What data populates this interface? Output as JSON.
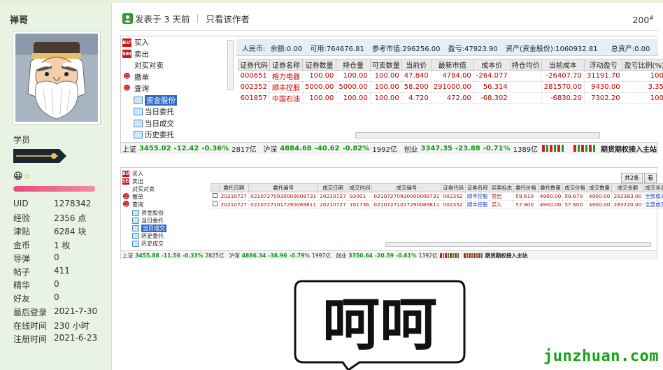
{
  "user": {
    "name": "禅哥",
    "rank": "学员",
    "progress_fraction": 0.9,
    "stats": [
      {
        "label": "UID",
        "value": "1278342"
      },
      {
        "label": "经验",
        "value": "2356 点"
      },
      {
        "label": "津贴",
        "value": "6284 块"
      },
      {
        "label": "金币",
        "value": "1 枚"
      },
      {
        "label": "导弹",
        "value": "0"
      },
      {
        "label": "帖子",
        "value": "411"
      },
      {
        "label": "精华",
        "value": "0"
      },
      {
        "label": "好友",
        "value": "0"
      },
      {
        "label": "最后登录",
        "value": "2021-7-30"
      },
      {
        "label": "在线时间",
        "value": "230 小时"
      },
      {
        "label": "注册时间",
        "value": "2021-6-23"
      }
    ]
  },
  "post": {
    "posted_label": "发表于 3 天前",
    "author_only_link": "只看该作者",
    "floor_number": "200",
    "floor_suffix": "#"
  },
  "shot1": {
    "tree": [
      {
        "label": "买入",
        "icon": "BUY",
        "color": "#c41c1c"
      },
      {
        "label": "卖出",
        "icon": "SELL",
        "color": "#c41c1c"
      },
      {
        "label": "对买对卖",
        "icon": "",
        "color": ""
      },
      {
        "label": "撤单",
        "icon": "bug",
        "color": ""
      },
      {
        "label": "查询",
        "icon": "bug",
        "color": ""
      },
      {
        "label": "资金股份",
        "icon": "folder",
        "selected": true
      },
      {
        "label": "当日委托",
        "icon": "folder"
      },
      {
        "label": "当日成交",
        "icon": "folder"
      },
      {
        "label": "历史委托",
        "icon": "folder"
      },
      {
        "label": "历史成交",
        "icon": "folder"
      }
    ],
    "account": {
      "currency": "人民币:",
      "balance": "余额:0.00",
      "available": "可用:764676.81",
      "ref_market_value": "参考市值:296256.00",
      "pnl": "盈亏:47923.90",
      "assets": "资产(资金股份):1060932.81",
      "total_assets": "总资产:0.00"
    },
    "columns": [
      "证券代码",
      "证券名称",
      "证券数量",
      "持仓量",
      "可卖数量",
      "当前价",
      "最新市值",
      "成本价",
      "持仓均价",
      "当前成本",
      "浮动盈亏",
      "盈亏比例(%)"
    ],
    "rows": [
      [
        "000651",
        "格力电器",
        "100.00",
        "100.00",
        "100.00",
        "47.840",
        "4784.00",
        "-264.077",
        "",
        "-26407.70",
        "31191.70",
        "100"
      ],
      [
        "002352",
        "顺丰控股",
        "5000.00",
        "5000.00",
        "100.00",
        "58.200",
        "291000.00",
        "56.314",
        "",
        "281570.00",
        "9430.00",
        "3.35"
      ],
      [
        "601857",
        "中国石油",
        "100.00",
        "100.00",
        "100.00",
        "4.720",
        "472.00",
        "-68.302",
        "",
        "-6830.20",
        "7302.20",
        "100"
      ]
    ],
    "status": {
      "sh_label": "上证",
      "sh_value": "3455.02",
      "sh_change": "-12.42",
      "sh_pct": "-0.36%",
      "sh_volume": "2817亿",
      "hs_label": "沪深",
      "hs_value": "4884.68",
      "hs_change": "-40.62",
      "hs_pct": "-0.82%",
      "hs_volume": "1992亿",
      "cy_label": "创业",
      "cy_value": "3347.35",
      "cy_change": "-23.88",
      "cy_pct": "-0.71%",
      "cy_volume": "1389亿",
      "link": "期货期权接入主站"
    }
  },
  "shot2": {
    "tree": [
      {
        "label": "买入",
        "icon": "BUY",
        "color": "#c41c1c"
      },
      {
        "label": "卖出",
        "icon": "SELL",
        "color": "#c41c1c"
      },
      {
        "label": "对买对卖",
        "icon": ""
      },
      {
        "label": "撤单",
        "icon": "bug"
      },
      {
        "label": "查询",
        "icon": "bug"
      },
      {
        "label": "资金股份",
        "icon": "folder"
      },
      {
        "label": "当日委托",
        "icon": "folder"
      },
      {
        "label": "当日成交",
        "icon": "folder",
        "selected": true
      },
      {
        "label": "历史委托",
        "icon": "folder"
      },
      {
        "label": "历史成交",
        "icon": "folder"
      }
    ],
    "tabs": [
      "共2条",
      "看"
    ],
    "columns": [
      "",
      "委托日期",
      "委托编号",
      "成交日期",
      "成交时间",
      "成交编号",
      "证券代码",
      "证券名称",
      "买卖标志",
      "委托价格",
      "委托数量",
      "成交价格",
      "成交数量",
      "成交金额",
      "成交状态"
    ],
    "rows": [
      [
        "",
        "20210727",
        "02107270930000008731",
        "20210727",
        "93001",
        "02107270930000008731",
        "002352",
        "顺丰控股",
        "卖出",
        "59.610",
        "4900.00",
        "59.670",
        "4900.00",
        "292383.00",
        "全部成交"
      ],
      [
        "",
        "20210727",
        "02107271017290069811",
        "20210727",
        "101736",
        "02107271017290069811",
        "002352",
        "顺丰控股",
        "买入",
        "57.800",
        "4900.00",
        "57.800",
        "4900.00",
        "283220.00",
        "全部成交"
      ]
    ],
    "status": {
      "sh_label": "上证",
      "sh_value": "3455.88",
      "sh_change": "-11.56",
      "sh_pct": "-0.33%",
      "sh_volume": "2825亿",
      "hs_label": "沪深",
      "hs_value": "4886.34",
      "hs_change": "-38.96",
      "hs_pct": "-0.79%",
      "hs_volume": "1997亿",
      "cy_label": "创业",
      "cy_value": "3350.64",
      "cy_change": "-20.59",
      "cy_pct": "-0.61%",
      "cy_volume": "1392亿",
      "link": "期货期权接入主站"
    }
  },
  "sticker": {
    "text": "呵呵"
  },
  "watermark": "junzhuan.com"
}
